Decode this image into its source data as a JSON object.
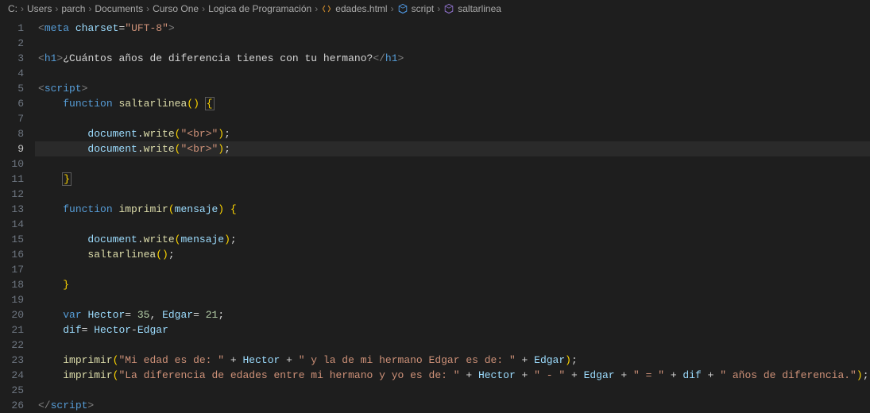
{
  "breadcrumb": {
    "items": [
      {
        "label": "C:",
        "icon": null
      },
      {
        "label": "Users",
        "icon": null
      },
      {
        "label": "parch",
        "icon": null
      },
      {
        "label": "Documents",
        "icon": null
      },
      {
        "label": "Curso One",
        "icon": null
      },
      {
        "label": "Logica de Programación",
        "icon": null
      },
      {
        "label": "edades.html",
        "icon": "file-code"
      },
      {
        "label": "script",
        "icon": "symbol-cube"
      },
      {
        "label": "saltarlinea",
        "icon": "symbol-cube"
      }
    ]
  },
  "gutter": {
    "lines": [
      "1",
      "2",
      "3",
      "4",
      "5",
      "6",
      "7",
      "8",
      "9",
      "10",
      "11",
      "12",
      "13",
      "14",
      "15",
      "16",
      "17",
      "18",
      "19",
      "20",
      "21",
      "22",
      "23",
      "24",
      "25",
      "26"
    ],
    "active": 9
  },
  "code": {
    "l1": {
      "open": "<",
      "tag": "meta",
      "sp": " ",
      "attr": "charset",
      "eq": "=",
      "q": "\"",
      "val": "UFT-8",
      "close": ">"
    },
    "l3": {
      "open": "<",
      "tag": "h1",
      "gt": ">",
      "text": "¿Cuántos años de diferencia tienes con tu hermano?",
      "closeOpen": "</",
      "closeTag": "h1",
      "closeGt": ">"
    },
    "l5": {
      "open": "<",
      "tag": "script",
      "gt": ">"
    },
    "l6": {
      "kw": "function",
      "sp": " ",
      "fn": "saltarlinea",
      "paren": "()",
      "sp2": " ",
      "brace": "{"
    },
    "l8": {
      "obj": "document",
      "dot": ".",
      "fn": "write",
      "open": "(",
      "str": "\"<br>\"",
      "close": ")",
      "semi": ";"
    },
    "l9": {
      "obj": "document",
      "dot": ".",
      "fn": "write",
      "open": "(",
      "str": "\"<br>\"",
      "close": ")",
      "semi": ";"
    },
    "l11": {
      "brace": "}"
    },
    "l13": {
      "kw": "function",
      "sp": " ",
      "fn": "imprimir",
      "open": "(",
      "param": "mensaje",
      "close": ")",
      "sp2": " ",
      "brace": "{"
    },
    "l15": {
      "obj": "document",
      "dot": ".",
      "fn": "write",
      "open": "(",
      "param": "mensaje",
      "close": ")",
      "semi": ";"
    },
    "l16": {
      "fn": "saltarlinea",
      "paren": "()",
      "semi": ";"
    },
    "l18": {
      "brace": "}"
    },
    "l20": {
      "kw": "var",
      "sp": " ",
      "v1": "Hector",
      "eq1": "= ",
      "n1": "35",
      "comma": ", ",
      "v2": "Edgar",
      "eq2": "= ",
      "n2": "21",
      "semi": ";"
    },
    "l21": {
      "v": "dif",
      "eq": "= ",
      "a": "Hector",
      "minus": "-",
      "b": "Edgar"
    },
    "l23": {
      "fn": "imprimir",
      "open": "(",
      "s1": "\"Mi edad es de: \"",
      "plus1": " + ",
      "v1": "Hector",
      "plus2": " + ",
      "s2": "\" y la de mi hermano Edgar es de: \"",
      "plus3": " + ",
      "v2": "Edgar",
      "close": ")",
      "semi": ";"
    },
    "l24": {
      "fn": "imprimir",
      "open": "(",
      "s1": "\"La diferencia de edades entre mi hermano y yo es de: \"",
      "plus1": " + ",
      "v1": "Hector",
      "plus2": " + ",
      "s2": "\" - \"",
      "plus3": " + ",
      "v2": "Edgar",
      "plus4": " + ",
      "s3": "\" = \"",
      "plus5": " + ",
      "v3": "dif",
      "plus6": " + ",
      "s4": "\" años de diferencia.\"",
      "close": ")",
      "semi": ";"
    },
    "l26": {
      "open": "</",
      "tag": "script",
      "gt": ">"
    }
  }
}
